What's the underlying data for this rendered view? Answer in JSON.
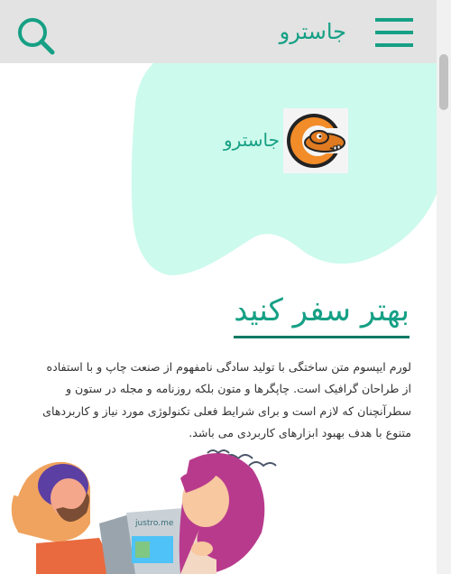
{
  "header": {
    "title": "جاسترو",
    "menu_icon": "hamburger-menu-icon",
    "search_icon": "search-icon",
    "accent_color": "#16a085",
    "background_color": "#e3e3e3"
  },
  "logo": {
    "text": "جاسترو",
    "image": "camel-c-logo"
  },
  "hero": {
    "title": "بهتر سفر کنید",
    "paragraph": "لورم ایپسوم متن ساختگی با تولید سادگی نامفهوم از صنعت چاپ و با استفاده از طراحان گرافیک است. چاپگرها و متون بلکه روزنامه و مجله در ستون و سطرآنچنان که لازم است و برای شرایط فعلی تکنولوژی مورد نیاز و کاربردهای متنوع با هدف بهبود ابزارهای کاربردی می باشد."
  },
  "illustration": {
    "name": "travelers-reading-newspaper",
    "newspaper_brand": "justro.me"
  },
  "colors": {
    "blob": "#ccfaec",
    "accent": "#16a085"
  }
}
